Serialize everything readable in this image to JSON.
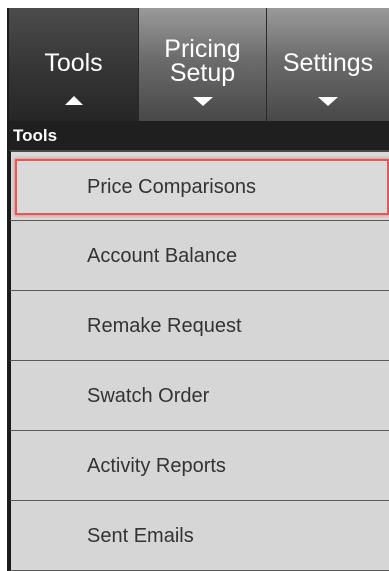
{
  "tabs": {
    "tools": {
      "label": "Tools"
    },
    "pricing_setup": {
      "line1": "Pricing",
      "line2": "Setup"
    },
    "settings": {
      "label": "Settings"
    }
  },
  "section": {
    "title": "Tools"
  },
  "menu": {
    "items": [
      {
        "label": "Price Comparisons",
        "selected": true
      },
      {
        "label": "Account Balance"
      },
      {
        "label": "Remake Request"
      },
      {
        "label": "Swatch Order"
      },
      {
        "label": "Activity Reports"
      },
      {
        "label": "Sent Emails"
      }
    ]
  },
  "colors": {
    "highlight_border": "#e05a5a",
    "menu_bg": "#d6d6d6",
    "header_bg": "#1f1f1f"
  }
}
